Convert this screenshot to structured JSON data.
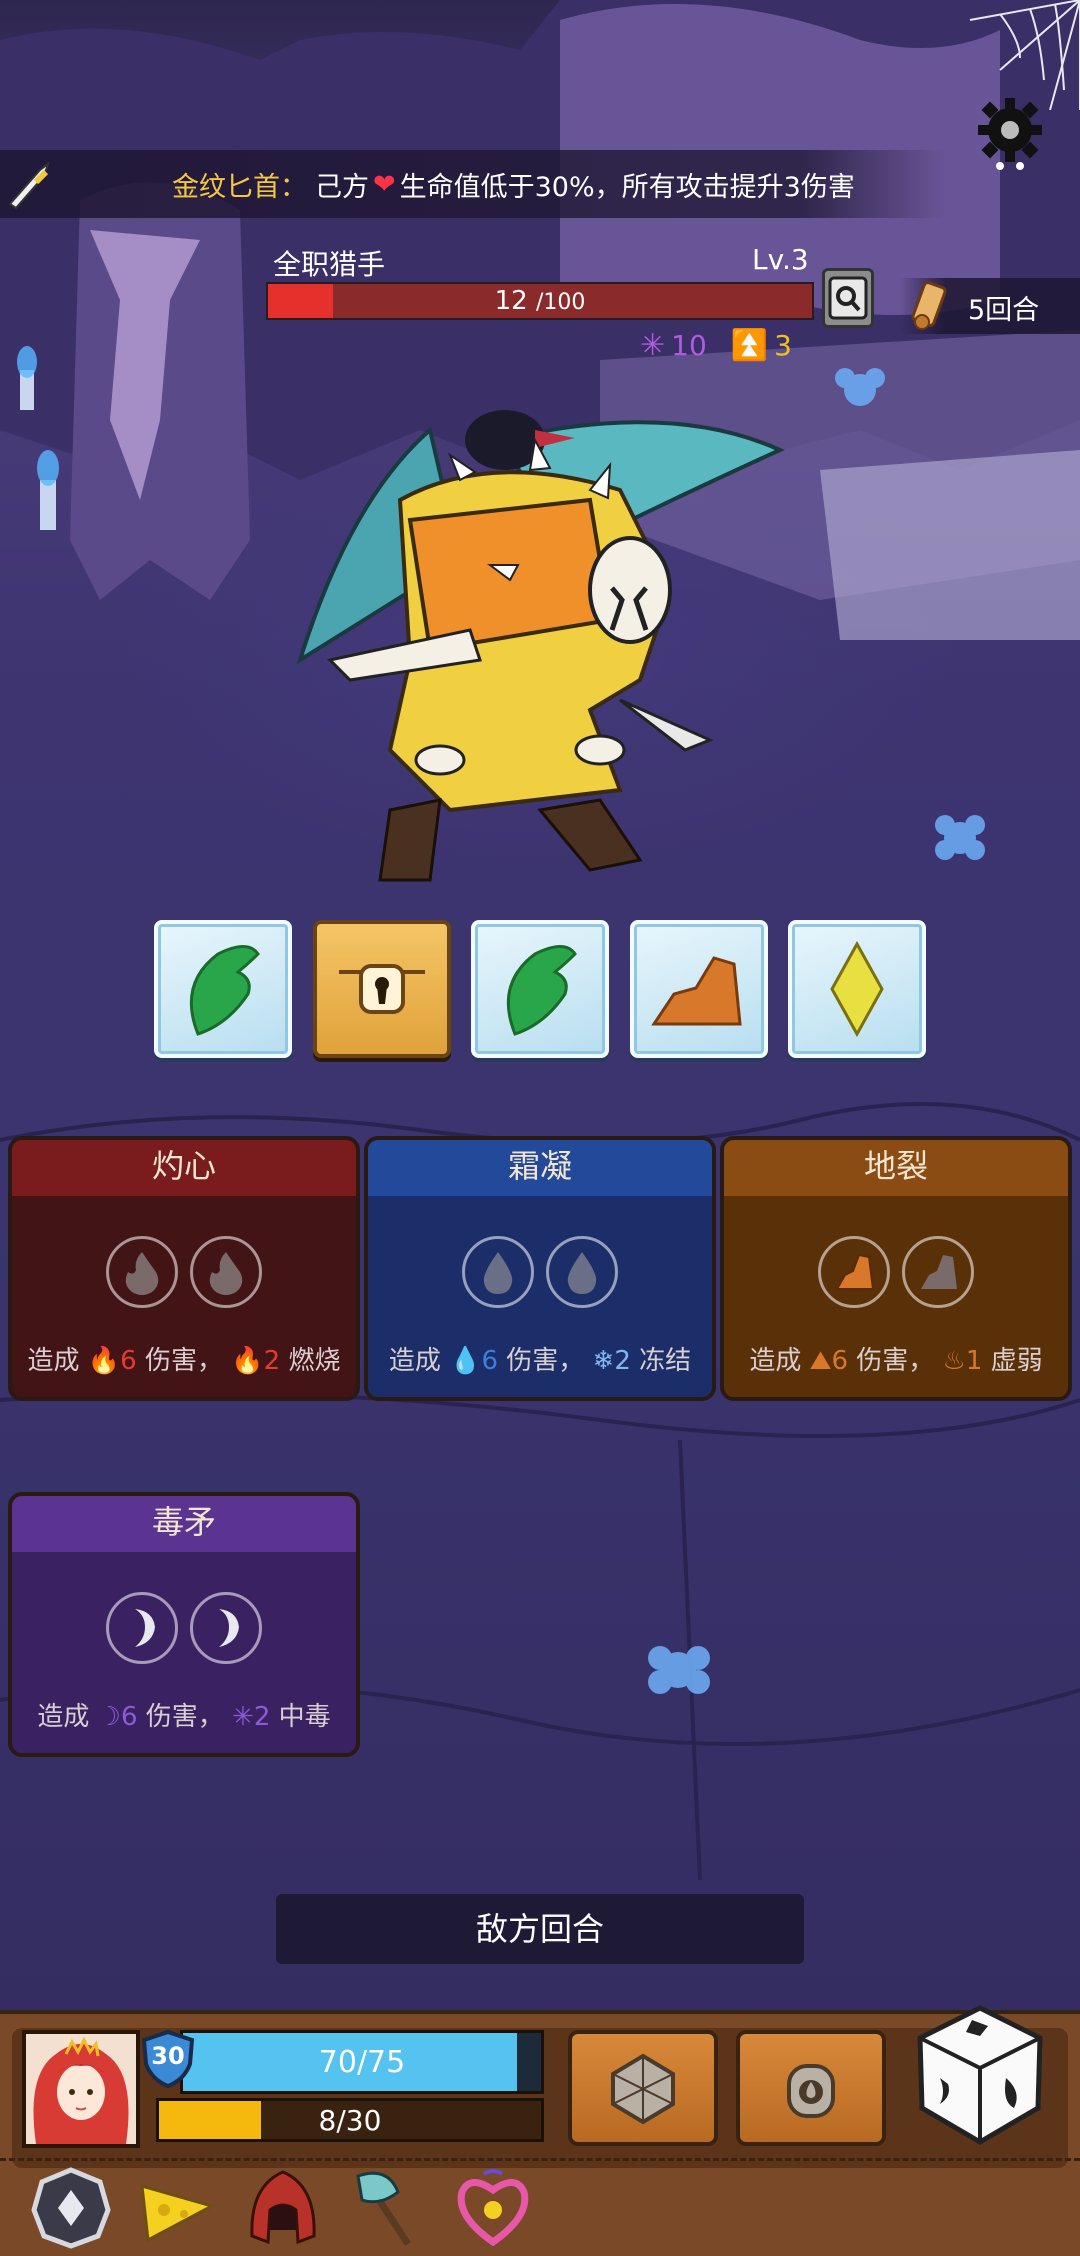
{
  "relic_banner": {
    "name": "金纹匕首",
    "separator": "：",
    "side": "己方",
    "description": "生命值低于30%，所有攻击提升3伤害"
  },
  "enemy": {
    "name": "全职猎手",
    "level": "Lv.3",
    "hp_text": "12",
    "hp_max_text": "/100",
    "hp_fraction": 0.12,
    "intent_poison": "10",
    "intent_shield": "3"
  },
  "turn_counter": "5回合",
  "dice_tray": [
    {
      "state": "frozen",
      "face": "leaf-icon",
      "color": "#2aa64a"
    },
    {
      "state": "locked",
      "face": "keyhole-lock-icon",
      "color": "#f5c567"
    },
    {
      "state": "frozen",
      "face": "leaf-icon",
      "color": "#2aa64a"
    },
    {
      "state": "frozen",
      "face": "rock-icon",
      "color": "#d8782a"
    },
    {
      "state": "frozen",
      "face": "diamond-icon",
      "color": "#e8e040"
    }
  ],
  "skills": [
    {
      "title": "灼心",
      "desc_prefix": "造成",
      "damage": "6",
      "desc_mid": "伤害，",
      "effect_value": "2",
      "effect_name": "燃烧",
      "color": "#7a1c1e"
    },
    {
      "title": "霜凝",
      "desc_prefix": "造成",
      "damage": "6",
      "desc_mid": "伤害，",
      "effect_value": "2",
      "effect_name": "冻结",
      "color": "#234a9a"
    },
    {
      "title": "地裂",
      "desc_prefix": "造成",
      "damage": "6",
      "desc_mid": "伤害，",
      "effect_value": "1",
      "effect_name": "虚弱",
      "color": "#8a4c12"
    },
    {
      "title": "毒矛",
      "desc_prefix": "造成",
      "damage": "6",
      "desc_mid": "伤害，",
      "effect_value": "2",
      "effect_name": "中毒",
      "color": "#5b3390"
    }
  ],
  "turn_banner": "敌方回合",
  "player": {
    "level": "30",
    "hp_text": "70/75",
    "hp_fraction": 0.933,
    "exp_text": "8/30",
    "exp_fraction": 0.267
  },
  "relics": [
    "compass-relic-icon",
    "cheese-relic-icon",
    "hood-relic-icon",
    "axe-relic-icon",
    "heart-amulet-relic-icon"
  ]
}
